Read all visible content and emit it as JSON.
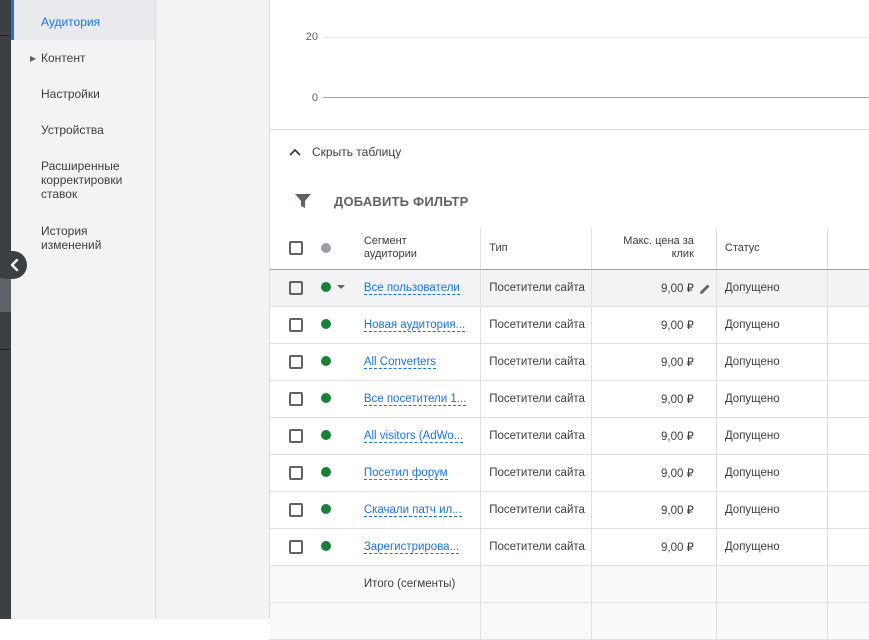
{
  "sidebar": {
    "items": [
      {
        "label": "Аудитория",
        "active": true
      },
      {
        "label": "Контент",
        "expandable": true
      },
      {
        "label": "Настройки"
      },
      {
        "label": "Устройства"
      },
      {
        "label": "Расширенные корректировки ставок"
      },
      {
        "label": "История изменений"
      }
    ]
  },
  "chart": {
    "y_ticks": [
      "20",
      "0"
    ]
  },
  "table_toggle_label": "Скрыть таблицу",
  "filter_label": "ДОБАВИТЬ ФИЛЬТР",
  "table": {
    "headers": {
      "name": "Сегмент аудитории",
      "type": "Тип",
      "bid": "Макс. цена за клик",
      "status": "Статус"
    },
    "rows": [
      {
        "name": "Все пользователи",
        "type": "Посетители сайта",
        "bid": "9,00 ₽",
        "status": "Допущено"
      },
      {
        "name": "Новая аудитория...",
        "type": "Посетители сайта",
        "bid": "9,00 ₽",
        "status": "Допущено"
      },
      {
        "name": "All Converters",
        "type": "Посетители сайта",
        "bid": "9,00 ₽",
        "status": "Допущено"
      },
      {
        "name": "Все посетители 1...",
        "type": "Посетители сайта",
        "bid": "9,00 ₽",
        "status": "Допущено"
      },
      {
        "name": "All visitors (AdWo...",
        "type": "Посетители сайта",
        "bid": "9,00 ₽",
        "status": "Допущено"
      },
      {
        "name": "Посетил форум",
        "type": "Посетители сайта",
        "bid": "9,00 ₽",
        "status": "Допущено"
      },
      {
        "name": "Скачали патч ил...",
        "type": "Посетители сайта",
        "bid": "9,00 ₽",
        "status": "Допущено"
      },
      {
        "name": "Зарегистрирова...",
        "type": "Посетители сайта",
        "bid": "9,00 ₽",
        "status": "Допущено"
      }
    ],
    "total_label": "Итого (сегменты)"
  },
  "colors": {
    "accent": "#1a73e8",
    "status_enabled": "#188038"
  }
}
